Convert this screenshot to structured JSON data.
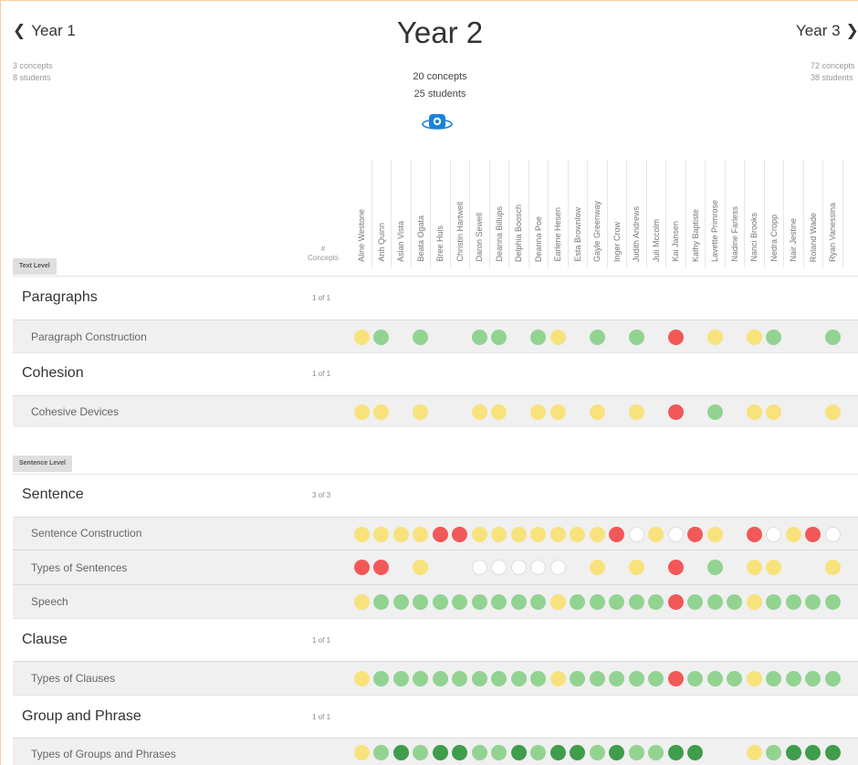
{
  "nav": {
    "prev_label": "Year 1",
    "prev_concepts": "3 concepts",
    "prev_students": "8 students",
    "next_label": "Year 3",
    "next_concepts": "72 concepts",
    "next_students": "38 students"
  },
  "header": {
    "title": "Year 2",
    "concepts": "20 concepts",
    "students": "25 students",
    "toggle_icon": "eye-toggle-icon"
  },
  "columns": {
    "concepts_header_1": "#",
    "concepts_header_2": "Concepts",
    "students": [
      "Aline Westone",
      "Anh Quinn",
      "Aslan Vista",
      "Beata Ogata",
      "Bree Huis",
      "Christin Hartwell",
      "Daron Sewell",
      "Deanna Billups",
      "Delphia Boosch",
      "Deanna Poe",
      "Earlene Hesen",
      "Esta Brownlow",
      "Gayle Greenway",
      "Inger Crow",
      "Judith Andrews",
      "Juli Mccolm",
      "Kai Jansen",
      "Kathy Baptiste",
      "Lavette Primrose",
      "Nadine Farless",
      "Nanci Brooks",
      "Nedra Cropp",
      "Nair Jestine",
      "Roland Wade",
      "Ryan Vanessina"
    ]
  },
  "colors": {
    "yellow": "#f8e27c",
    "light_green": "#92d392",
    "dark_green": "#3f9d4c",
    "red": "#f25858",
    "empty": "#ffffff",
    "empty_border": "#dddddd"
  },
  "sections": [
    {
      "level_label": "Text Level",
      "groups": [
        {
          "name": "Paragraphs",
          "count": "1 of 1",
          "concepts": [
            {
              "name": "Paragraph Construction",
              "marks": [
                "Y",
                "L",
                "",
                "L",
                "",
                "",
                "L",
                "L",
                "",
                "L",
                "Y",
                "",
                "L",
                "",
                "L",
                "",
                "R",
                "",
                "Y",
                "",
                "Y",
                "L",
                "",
                "",
                "L"
              ]
            }
          ]
        },
        {
          "name": "Cohesion",
          "count": "1 of 1",
          "concepts": [
            {
              "name": "Cohesive Devices",
              "marks": [
                "Y",
                "Y",
                "",
                "Y",
                "",
                "",
                "Y",
                "Y",
                "",
                "Y",
                "Y",
                "",
                "Y",
                "",
                "Y",
                "",
                "R",
                "",
                "L",
                "",
                "Y",
                "Y",
                "",
                "",
                "Y"
              ]
            }
          ]
        }
      ]
    },
    {
      "level_label": "Sentence Level",
      "groups": [
        {
          "name": "Sentence",
          "count": "3 of 3",
          "concepts": [
            {
              "name": "Sentence Construction",
              "marks": [
                "Y",
                "Y",
                "Y",
                "Y",
                "R",
                "R",
                "Y",
                "Y",
                "Y",
                "Y",
                "Y",
                "Y",
                "Y",
                "R",
                "W",
                "Y",
                "W",
                "R",
                "Y",
                "",
                "R",
                "W",
                "Y",
                "R",
                "W"
              ]
            },
            {
              "name": "Types of Sentences",
              "marks": [
                "R",
                "R",
                "",
                "Y",
                "",
                "",
                "W",
                "W",
                "W",
                "W",
                "W",
                "",
                "Y",
                "",
                "Y",
                "",
                "R",
                "",
                "L",
                "",
                "Y",
                "Y",
                "",
                "",
                "Y"
              ]
            },
            {
              "name": "Speech",
              "marks": [
                "Y",
                "L",
                "L",
                "L",
                "L",
                "L",
                "L",
                "L",
                "L",
                "L",
                "Y",
                "L",
                "L",
                "L",
                "L",
                "L",
                "R",
                "L",
                "L",
                "L",
                "Y",
                "L",
                "L",
                "L",
                "L"
              ]
            }
          ]
        },
        {
          "name": "Clause",
          "count": "1 of 1",
          "concepts": [
            {
              "name": "Types of Clauses",
              "marks": [
                "Y",
                "L",
                "L",
                "L",
                "L",
                "L",
                "L",
                "L",
                "L",
                "L",
                "Y",
                "L",
                "L",
                "L",
                "L",
                "L",
                "R",
                "L",
                "L",
                "L",
                "Y",
                "L",
                "L",
                "L",
                "L"
              ]
            }
          ]
        },
        {
          "name": "Group and Phrase",
          "count": "1 of 1",
          "concepts": [
            {
              "name": "Types of Groups and Phrases",
              "marks": [
                "Y",
                "L",
                "D",
                "L",
                "D",
                "D",
                "L",
                "L",
                "D",
                "L",
                "D",
                "D",
                "L",
                "D",
                "L",
                "L",
                "D",
                "D",
                "",
                "",
                "Y",
                "L",
                "D",
                "D",
                "D"
              ]
            }
          ]
        }
      ]
    }
  ]
}
